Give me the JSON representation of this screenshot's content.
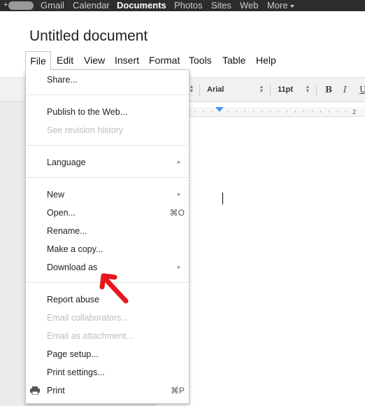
{
  "topbar": {
    "plus": "+",
    "links": [
      "Gmail",
      "Calendar",
      "Documents",
      "Photos",
      "Sites",
      "Web",
      "More"
    ],
    "active": "Documents"
  },
  "document": {
    "title": "Untitled document"
  },
  "menubar": {
    "items": [
      "File",
      "Edit",
      "View",
      "Insert",
      "Format",
      "Tools",
      "Table",
      "Help"
    ]
  },
  "toolbar": {
    "font": "Arial",
    "size": "11pt",
    "bold": "B",
    "italic": "I",
    "underline": "U"
  },
  "ruler": {
    "number": "2"
  },
  "file_menu": {
    "items": [
      {
        "label": "Share...",
        "enabled": true
      },
      {
        "label": "Publish to the Web...",
        "enabled": true
      },
      {
        "label": "See revision history",
        "enabled": false
      },
      {
        "label": "Language",
        "enabled": true,
        "submenu": true
      },
      {
        "label": "New",
        "enabled": true,
        "submenu": true
      },
      {
        "label": "Open...",
        "enabled": true,
        "shortcut": "⌘O"
      },
      {
        "label": "Rename...",
        "enabled": true
      },
      {
        "label": "Make a copy...",
        "enabled": true
      },
      {
        "label": "Download as",
        "enabled": true,
        "submenu": true
      },
      {
        "label": "Report abuse",
        "enabled": true
      },
      {
        "label": "Email collaborators...",
        "enabled": false
      },
      {
        "label": "Email as attachment...",
        "enabled": false
      },
      {
        "label": "Page setup...",
        "enabled": true
      },
      {
        "label": "Print settings...",
        "enabled": true
      },
      {
        "label": "Print",
        "enabled": true,
        "shortcut": "⌘P",
        "icon": "printer-icon"
      }
    ],
    "submenu_glyph": "►"
  },
  "colors": {
    "topbar_bg": "#2d2d2d",
    "accent_blue": "#4d90fe",
    "annotation_red": "#e8171e",
    "disabled_text": "#bcbcbc"
  }
}
